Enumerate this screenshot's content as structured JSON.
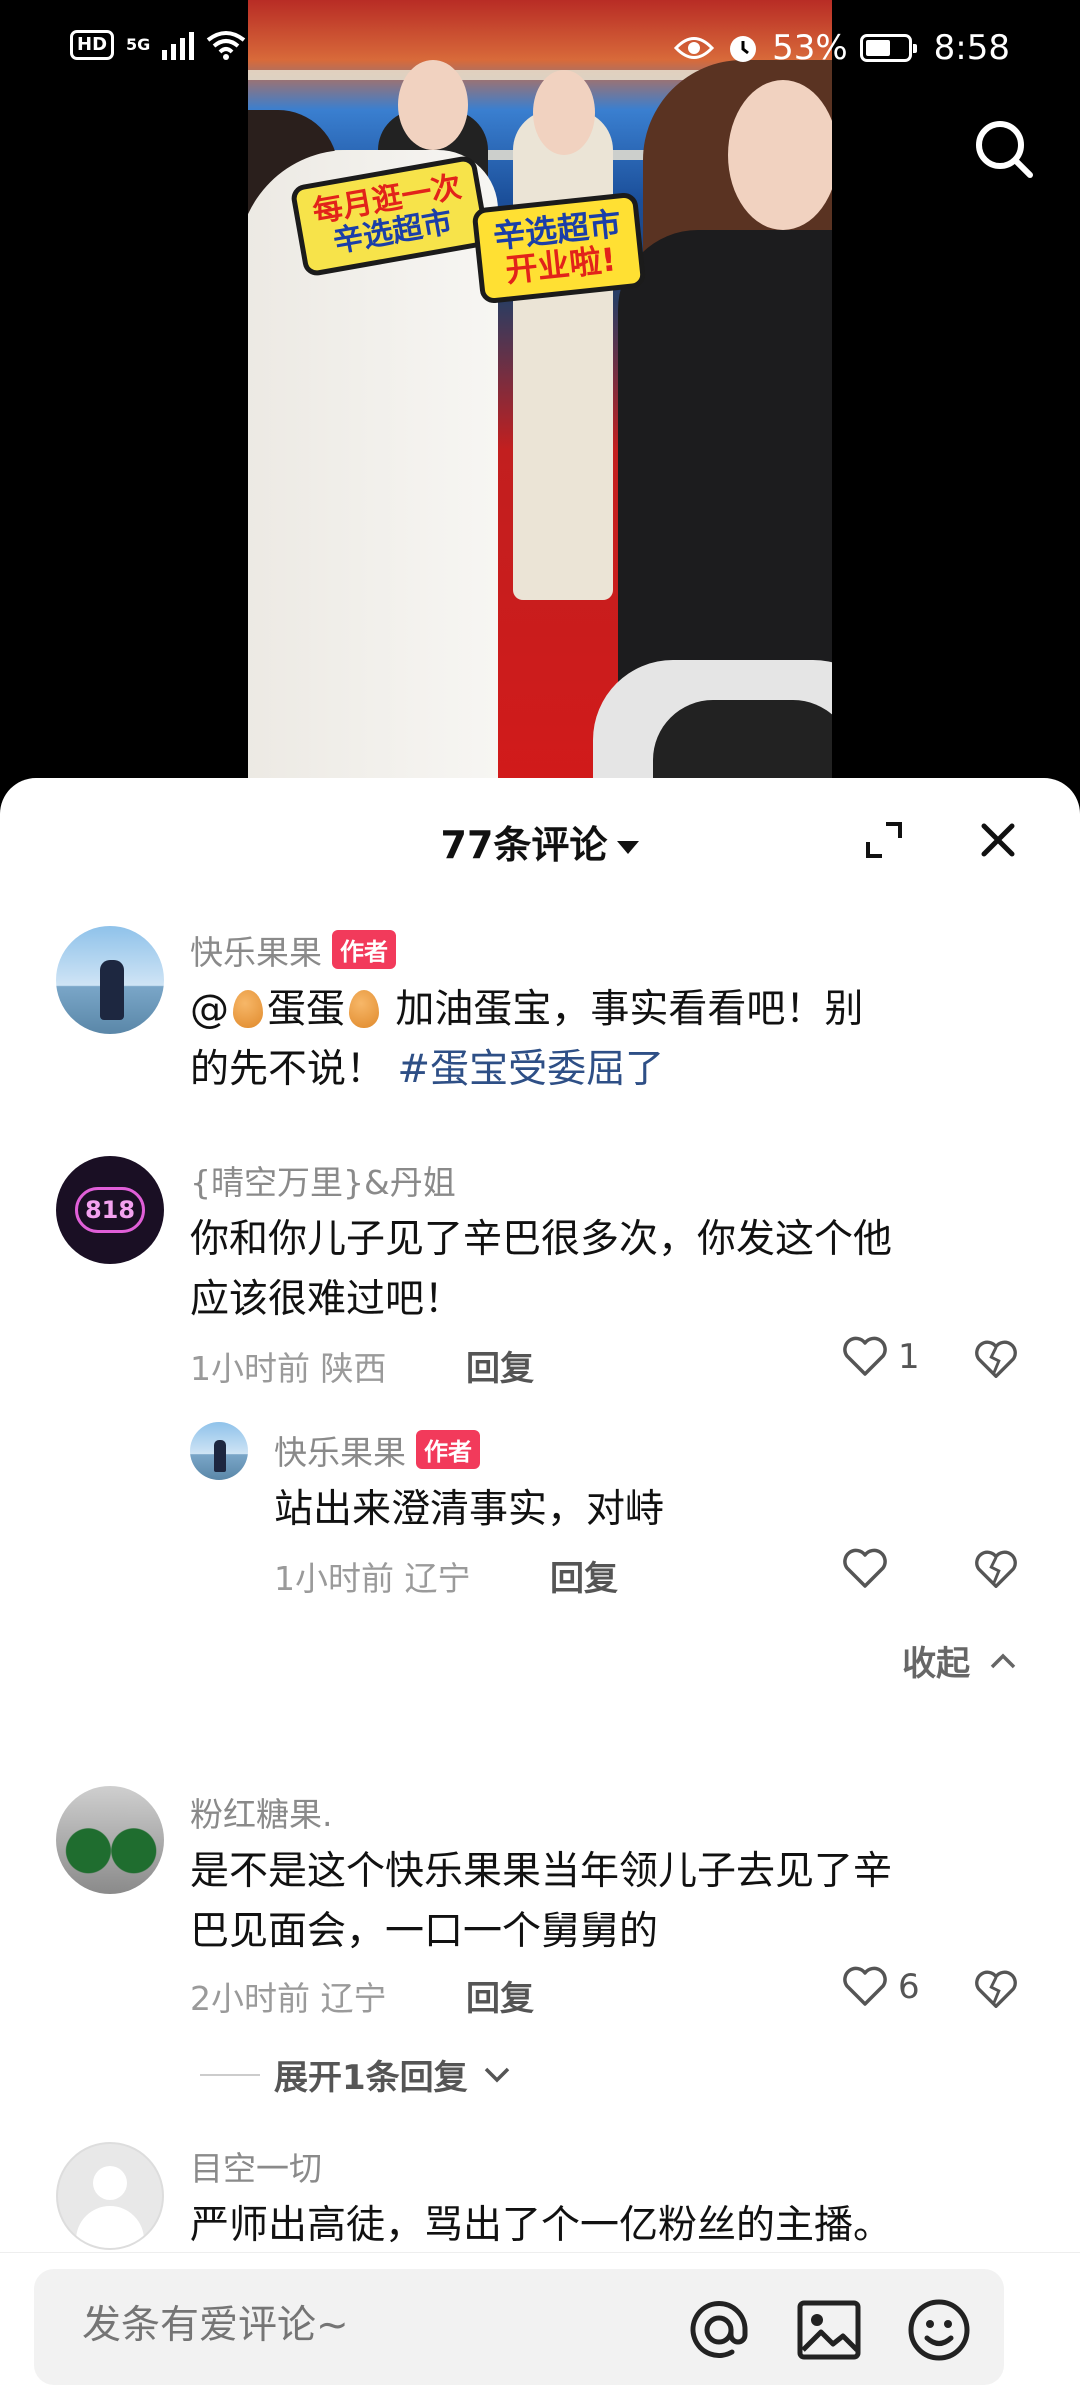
{
  "status_bar": {
    "hd": "HD",
    "network": "5G",
    "battery": "53%",
    "time": "8:58"
  },
  "video": {
    "sign1_line1": "每月逛一次",
    "sign1_line2": "辛选超市",
    "sign2_line1": "辛选超市",
    "sign2_line2": "开业啦!",
    "search_icon": "search-icon"
  },
  "sheet": {
    "title": "77条评论"
  },
  "comments": [
    {
      "user": "快乐果果",
      "badge": "作者",
      "text_prefix": "@",
      "text_mention": "蛋蛋",
      "text_line1_rest": " 加油蛋宝，事实看看吧！别",
      "text_line2": "的先不说！ ",
      "hashtag": "#蛋宝受委屈了"
    },
    {
      "user": "{晴空万里}&丹姐",
      "text_line1": "你和你儿子见了辛巴很多次，你发这个他",
      "text_line2": "应该很难过吧！",
      "time": "1小时前",
      "location": "陕西",
      "reply": "回复",
      "likes": "1",
      "avatar_text": "818"
    },
    {
      "user": "快乐果果",
      "badge": "作者",
      "text_line1": "站出来澄清事实，对峙",
      "time": "1小时前",
      "location": "辽宁",
      "reply": "回复",
      "likes": "",
      "collapse": "收起"
    },
    {
      "user": "粉红糖果.",
      "text_line1": "是不是这个快乐果果当年领儿子去见了辛",
      "text_line2": "巴见面会，一口一个舅舅的",
      "time": "2小时前",
      "location": "辽宁",
      "reply": "回复",
      "likes": "6",
      "expand": "展开1条回复"
    },
    {
      "user": "目空一切",
      "text_line1": "严师出高徒，骂出了个一亿粉丝的主播。"
    }
  ],
  "input": {
    "placeholder": "发条有爱评论~"
  },
  "colors": {
    "badge": "#f23a5b",
    "hashtag": "#2e4f86"
  }
}
